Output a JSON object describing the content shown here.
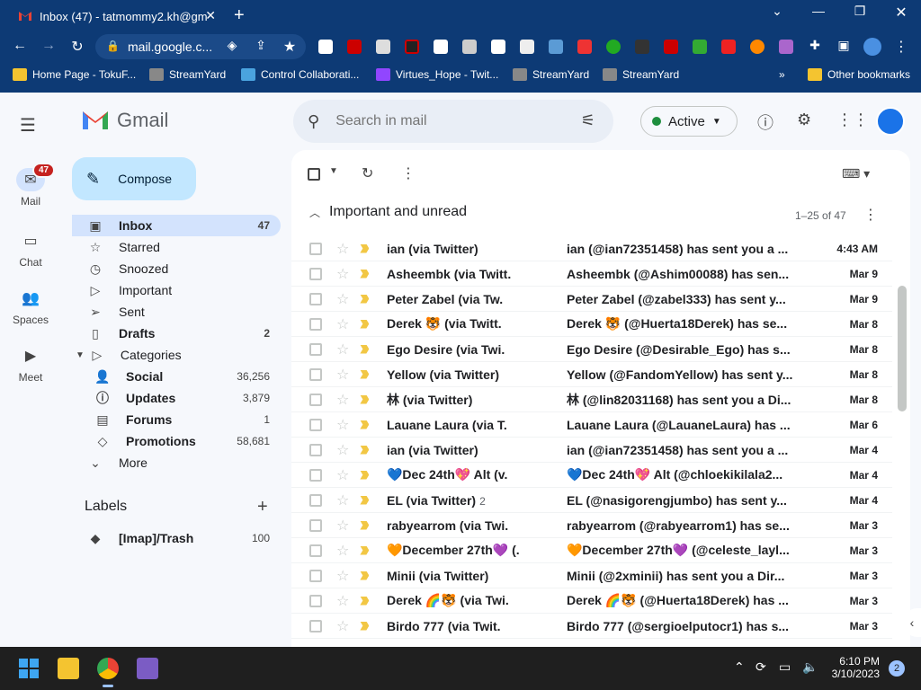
{
  "browser": {
    "tab_title": "Inbox (47) - tatmommy2.kh@gm",
    "url": "mail.google.c...",
    "bookmarks": [
      "Home Page - TokuF...",
      "StreamYard",
      "Control Collaborati...",
      "Virtues_Hope - Twit...",
      "StreamYard",
      "StreamYard"
    ],
    "other_bookmarks": "Other bookmarks"
  },
  "rail": {
    "mail": "Mail",
    "mail_badge": "47",
    "chat": "Chat",
    "spaces": "Spaces",
    "meet": "Meet"
  },
  "gmail": {
    "logo_text": "Gmail",
    "compose": "Compose",
    "search_placeholder": "Search in mail",
    "status": "Active"
  },
  "nav": [
    {
      "label": "Inbox",
      "count": "47",
      "icon": "inbox-icon"
    },
    {
      "label": "Starred",
      "count": "",
      "icon": "star-icon"
    },
    {
      "label": "Snoozed",
      "count": "",
      "icon": "clock-icon"
    },
    {
      "label": "Important",
      "count": "",
      "icon": "label-important-icon"
    },
    {
      "label": "Sent",
      "count": "",
      "icon": "send-icon"
    },
    {
      "label": "Drafts",
      "count": "2",
      "icon": "file-icon"
    },
    {
      "label": "Categories",
      "count": "",
      "icon": "label-icon"
    },
    {
      "label": "Social",
      "count": "36,256",
      "icon": "people-icon"
    },
    {
      "label": "Updates",
      "count": "3,879",
      "icon": "info-icon"
    },
    {
      "label": "Forums",
      "count": "1",
      "icon": "forum-icon"
    },
    {
      "label": "Promotions",
      "count": "58,681",
      "icon": "tag-icon"
    },
    {
      "label": "More",
      "count": "",
      "icon": "chevron-down-icon"
    }
  ],
  "labels": {
    "title": "Labels",
    "items": [
      {
        "label": "[Imap]/Trash",
        "count": "100"
      }
    ]
  },
  "list": {
    "section": "Important and unread",
    "range": "1–25 of 47",
    "rows": [
      {
        "sender": "ian (via Twitter)",
        "count": "",
        "subject": "ian (@ian72351458) has sent you a ...",
        "date": "4:43 AM"
      },
      {
        "sender": "Asheembk (via Twitt.",
        "count": "",
        "subject": "Asheembk (@Ashim00088) has sen...",
        "date": "Mar 9"
      },
      {
        "sender": "Peter Zabel (via Tw.",
        "count": "",
        "subject": "Peter Zabel (@zabel333) has sent y...",
        "date": "Mar 9"
      },
      {
        "sender": "Derek 🐯 (via Twitt.",
        "count": "",
        "subject": "Derek 🐯 (@Huerta18Derek) has se...",
        "date": "Mar 8"
      },
      {
        "sender": "Ego Desire (via Twi.",
        "count": "",
        "subject": "Ego Desire (@Desirable_Ego) has s...",
        "date": "Mar 8"
      },
      {
        "sender": "Yellow (via Twitter)",
        "count": "",
        "subject": "Yellow (@FandomYellow) has sent y...",
        "date": "Mar 8"
      },
      {
        "sender": "林 (via Twitter)",
        "count": "",
        "subject": "林 (@lin82031168) has sent you a Di...",
        "date": "Mar 8"
      },
      {
        "sender": "Lauane Laura (via T.",
        "count": "",
        "subject": "Lauane Laura (@LauaneLaura) has ...",
        "date": "Mar 6"
      },
      {
        "sender": "ian (via Twitter)",
        "count": "",
        "subject": "ian (@ian72351458) has sent you a ...",
        "date": "Mar 4"
      },
      {
        "sender": "💙Dec 24th💖 Alt (v.",
        "count": "",
        "subject": "💙Dec 24th💖 Alt (@chloekikilala2...",
        "date": "Mar 4"
      },
      {
        "sender": "EL (via Twitter)",
        "count": "2",
        "subject": "EL (@nasigorengjumbo) has sent y...",
        "date": "Mar 4"
      },
      {
        "sender": "rabyearrom (via Twi.",
        "count": "",
        "subject": "rabyearrom (@rabyearrom1) has se...",
        "date": "Mar 3"
      },
      {
        "sender": "🧡December 27th💜 (.",
        "count": "",
        "subject": "🧡December 27th💜 (@celeste_layl...",
        "date": "Mar 3"
      },
      {
        "sender": "Minii (via Twitter)",
        "count": "",
        "subject": "Minii (@2xminii) has sent you a Dir...",
        "date": "Mar 3"
      },
      {
        "sender": "Derek 🌈🐯 (via Twi.",
        "count": "",
        "subject": "Derek 🌈🐯 (@Huerta18Derek) has ...",
        "date": "Mar 3"
      },
      {
        "sender": "Birdo 777 (via Twit.",
        "count": "",
        "subject": "Birdo 777 (@sergioelputocr1) has s...",
        "date": "Mar 3"
      }
    ]
  },
  "taskbar": {
    "time": "6:10 PM",
    "date": "3/10/2023",
    "notif_count": "2"
  },
  "colors": {
    "chrome": "#0d3a75",
    "compose": "#c2e7ff",
    "selected": "#d3e3fd",
    "important": "#f2c744"
  }
}
